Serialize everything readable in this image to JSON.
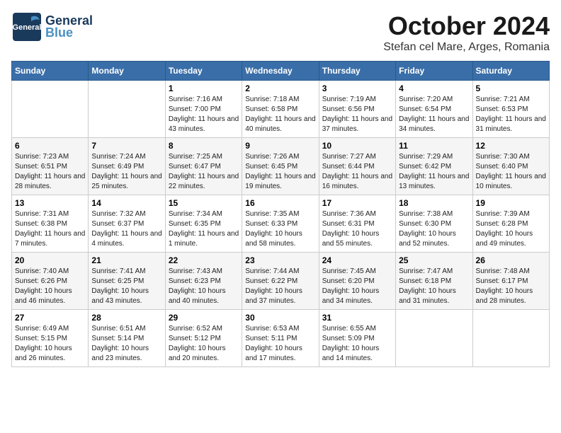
{
  "header": {
    "logo_general": "General",
    "logo_blue": "Blue",
    "month": "October 2024",
    "location": "Stefan cel Mare, Arges, Romania"
  },
  "weekdays": [
    "Sunday",
    "Monday",
    "Tuesday",
    "Wednesday",
    "Thursday",
    "Friday",
    "Saturday"
  ],
  "weeks": [
    [
      {
        "day": "",
        "info": ""
      },
      {
        "day": "",
        "info": ""
      },
      {
        "day": "1",
        "info": "Sunrise: 7:16 AM\nSunset: 7:00 PM\nDaylight: 11 hours and 43 minutes."
      },
      {
        "day": "2",
        "info": "Sunrise: 7:18 AM\nSunset: 6:58 PM\nDaylight: 11 hours and 40 minutes."
      },
      {
        "day": "3",
        "info": "Sunrise: 7:19 AM\nSunset: 6:56 PM\nDaylight: 11 hours and 37 minutes."
      },
      {
        "day": "4",
        "info": "Sunrise: 7:20 AM\nSunset: 6:54 PM\nDaylight: 11 hours and 34 minutes."
      },
      {
        "day": "5",
        "info": "Sunrise: 7:21 AM\nSunset: 6:53 PM\nDaylight: 11 hours and 31 minutes."
      }
    ],
    [
      {
        "day": "6",
        "info": "Sunrise: 7:23 AM\nSunset: 6:51 PM\nDaylight: 11 hours and 28 minutes."
      },
      {
        "day": "7",
        "info": "Sunrise: 7:24 AM\nSunset: 6:49 PM\nDaylight: 11 hours and 25 minutes."
      },
      {
        "day": "8",
        "info": "Sunrise: 7:25 AM\nSunset: 6:47 PM\nDaylight: 11 hours and 22 minutes."
      },
      {
        "day": "9",
        "info": "Sunrise: 7:26 AM\nSunset: 6:45 PM\nDaylight: 11 hours and 19 minutes."
      },
      {
        "day": "10",
        "info": "Sunrise: 7:27 AM\nSunset: 6:44 PM\nDaylight: 11 hours and 16 minutes."
      },
      {
        "day": "11",
        "info": "Sunrise: 7:29 AM\nSunset: 6:42 PM\nDaylight: 11 hours and 13 minutes."
      },
      {
        "day": "12",
        "info": "Sunrise: 7:30 AM\nSunset: 6:40 PM\nDaylight: 11 hours and 10 minutes."
      }
    ],
    [
      {
        "day": "13",
        "info": "Sunrise: 7:31 AM\nSunset: 6:38 PM\nDaylight: 11 hours and 7 minutes."
      },
      {
        "day": "14",
        "info": "Sunrise: 7:32 AM\nSunset: 6:37 PM\nDaylight: 11 hours and 4 minutes."
      },
      {
        "day": "15",
        "info": "Sunrise: 7:34 AM\nSunset: 6:35 PM\nDaylight: 11 hours and 1 minute."
      },
      {
        "day": "16",
        "info": "Sunrise: 7:35 AM\nSunset: 6:33 PM\nDaylight: 10 hours and 58 minutes."
      },
      {
        "day": "17",
        "info": "Sunrise: 7:36 AM\nSunset: 6:31 PM\nDaylight: 10 hours and 55 minutes."
      },
      {
        "day": "18",
        "info": "Sunrise: 7:38 AM\nSunset: 6:30 PM\nDaylight: 10 hours and 52 minutes."
      },
      {
        "day": "19",
        "info": "Sunrise: 7:39 AM\nSunset: 6:28 PM\nDaylight: 10 hours and 49 minutes."
      }
    ],
    [
      {
        "day": "20",
        "info": "Sunrise: 7:40 AM\nSunset: 6:26 PM\nDaylight: 10 hours and 46 minutes."
      },
      {
        "day": "21",
        "info": "Sunrise: 7:41 AM\nSunset: 6:25 PM\nDaylight: 10 hours and 43 minutes."
      },
      {
        "day": "22",
        "info": "Sunrise: 7:43 AM\nSunset: 6:23 PM\nDaylight: 10 hours and 40 minutes."
      },
      {
        "day": "23",
        "info": "Sunrise: 7:44 AM\nSunset: 6:22 PM\nDaylight: 10 hours and 37 minutes."
      },
      {
        "day": "24",
        "info": "Sunrise: 7:45 AM\nSunset: 6:20 PM\nDaylight: 10 hours and 34 minutes."
      },
      {
        "day": "25",
        "info": "Sunrise: 7:47 AM\nSunset: 6:18 PM\nDaylight: 10 hours and 31 minutes."
      },
      {
        "day": "26",
        "info": "Sunrise: 7:48 AM\nSunset: 6:17 PM\nDaylight: 10 hours and 28 minutes."
      }
    ],
    [
      {
        "day": "27",
        "info": "Sunrise: 6:49 AM\nSunset: 5:15 PM\nDaylight: 10 hours and 26 minutes."
      },
      {
        "day": "28",
        "info": "Sunrise: 6:51 AM\nSunset: 5:14 PM\nDaylight: 10 hours and 23 minutes."
      },
      {
        "day": "29",
        "info": "Sunrise: 6:52 AM\nSunset: 5:12 PM\nDaylight: 10 hours and 20 minutes."
      },
      {
        "day": "30",
        "info": "Sunrise: 6:53 AM\nSunset: 5:11 PM\nDaylight: 10 hours and 17 minutes."
      },
      {
        "day": "31",
        "info": "Sunrise: 6:55 AM\nSunset: 5:09 PM\nDaylight: 10 hours and 14 minutes."
      },
      {
        "day": "",
        "info": ""
      },
      {
        "day": "",
        "info": ""
      }
    ]
  ]
}
